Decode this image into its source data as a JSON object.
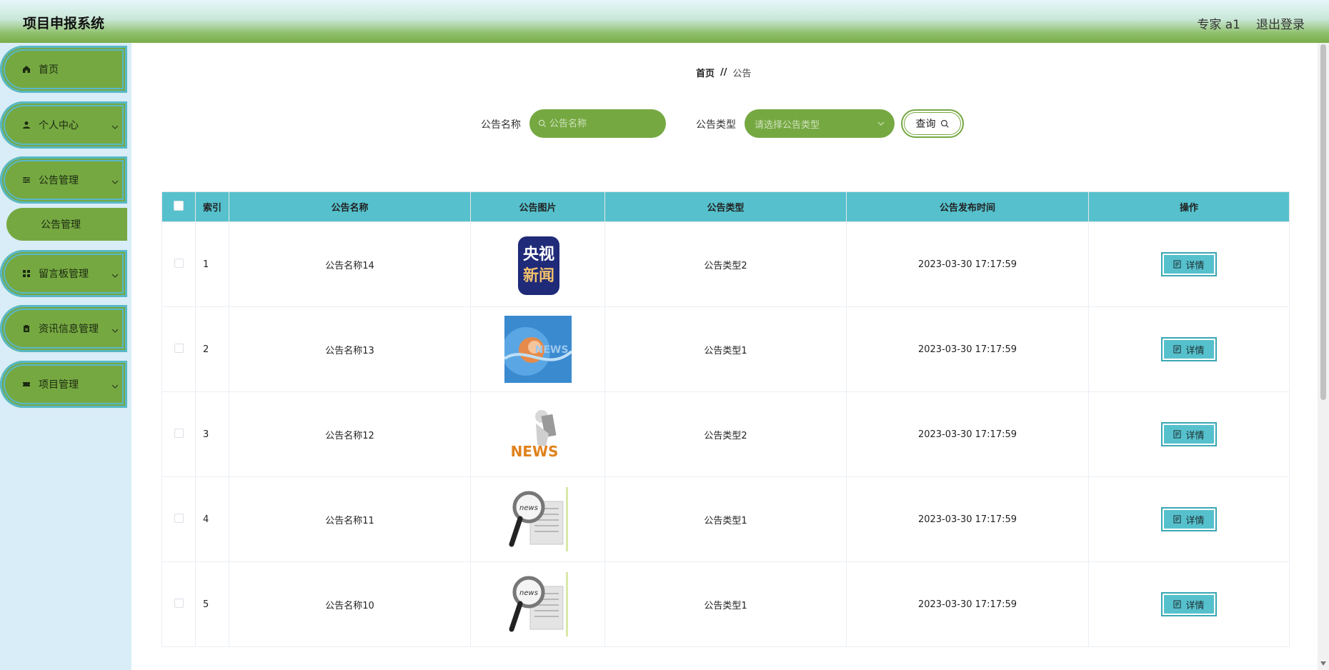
{
  "header": {
    "title": "项目申报系统",
    "user_label": "专家 a1",
    "logout_label": "退出登录"
  },
  "sidebar": {
    "items": [
      {
        "label": "首页",
        "icon": "home-icon"
      },
      {
        "label": "个人中心",
        "icon": "user-icon"
      },
      {
        "label": "公告管理",
        "icon": "sliders-icon"
      },
      {
        "label": "留言板管理",
        "icon": "grid-icon"
      },
      {
        "label": "资讯信息管理",
        "icon": "clipboard-icon"
      },
      {
        "label": "项目管理",
        "icon": "ticket-icon"
      }
    ],
    "submenu": {
      "label": "公告管理"
    }
  },
  "breadcrumb": {
    "home": "首页",
    "separator": "//",
    "current": "公告"
  },
  "search": {
    "name_label": "公告名称",
    "name_placeholder": "公告名称",
    "type_label": "公告类型",
    "type_placeholder": "请选择公告类型",
    "query_label": "查询"
  },
  "table": {
    "headers": [
      "索引",
      "公告名称",
      "公告图片",
      "公告类型",
      "公告发布时间",
      "操作"
    ],
    "detail_label": "详情",
    "rows": [
      {
        "index": "1",
        "name": "公告名称14",
        "image": "cctv-news-logo",
        "type": "公告类型2",
        "time": "2023-03-30 17:17:59"
      },
      {
        "index": "2",
        "name": "公告名称13",
        "image": "globe-news-image",
        "type": "公告类型1",
        "time": "2023-03-30 17:17:59"
      },
      {
        "index": "3",
        "name": "公告名称12",
        "image": "news-figure-image",
        "type": "公告类型2",
        "time": "2023-03-30 17:17:59"
      },
      {
        "index": "4",
        "name": "公告名称11",
        "image": "magnifier-newspaper-image",
        "type": "公告类型1",
        "time": "2023-03-30 17:17:59"
      },
      {
        "index": "5",
        "name": "公告名称10",
        "image": "magnifier-newspaper-image",
        "type": "公告类型1",
        "time": "2023-03-30 17:17:59"
      }
    ]
  },
  "colors": {
    "accent_green": "#76a842",
    "table_header": "#56c1cd",
    "sidebar_bg": "#d8edf7"
  }
}
